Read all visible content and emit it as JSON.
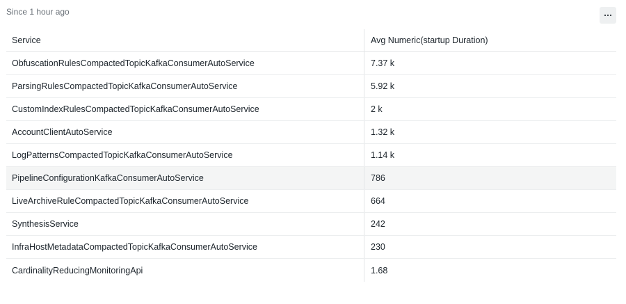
{
  "header": {
    "since_text": "Since 1 hour ago",
    "more_icon": "more-horizontal-icon"
  },
  "table": {
    "columns": [
      "Service",
      "Avg Numeric(startup Duration)"
    ],
    "rows": [
      {
        "service": "ObfuscationRulesCompactedTopicKafkaConsumerAutoService",
        "value": "7.37 k"
      },
      {
        "service": "ParsingRulesCompactedTopicKafkaConsumerAutoService",
        "value": "5.92 k"
      },
      {
        "service": "CustomIndexRulesCompactedTopicKafkaConsumerAutoService",
        "value": "2 k"
      },
      {
        "service": "AccountClientAutoService",
        "value": "1.32 k"
      },
      {
        "service": "LogPatternsCompactedTopicKafkaConsumerAutoService",
        "value": "1.14 k"
      },
      {
        "service": "PipelineConfigurationKafkaConsumerAutoService",
        "value": "786"
      },
      {
        "service": "LiveArchiveRuleCompactedTopicKafkaConsumerAutoService",
        "value": "664"
      },
      {
        "service": "SynthesisService",
        "value": "242"
      },
      {
        "service": "InfraHostMetadataCompactedTopicKafkaConsumerAutoService",
        "value": "230"
      },
      {
        "service": "CardinalityReducingMonitoringApi",
        "value": "1.68"
      }
    ],
    "highlighted_row_index": 5
  },
  "colors": {
    "border": "#eceeef",
    "highlight": "#f4f5f5",
    "muted_text": "#6b7279",
    "button_bg": "#eef0f1"
  }
}
